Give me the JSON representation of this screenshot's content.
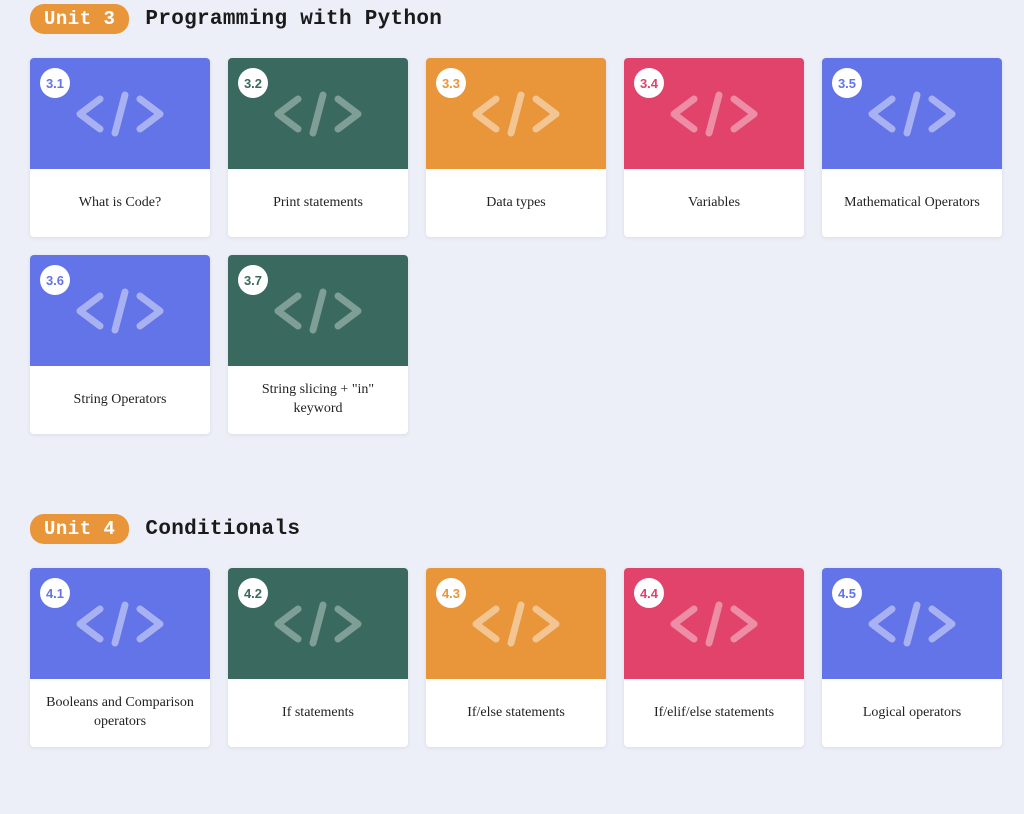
{
  "units": [
    {
      "badge": "Unit 3",
      "title": "Programming with Python",
      "lessons": [
        {
          "num": "3.1",
          "label": "What is Code?",
          "color": "blue"
        },
        {
          "num": "3.2",
          "label": "Print statements",
          "color": "teal"
        },
        {
          "num": "3.3",
          "label": "Data types",
          "color": "orange"
        },
        {
          "num": "3.4",
          "label": "Variables",
          "color": "pink"
        },
        {
          "num": "3.5",
          "label": "Mathematical Operators",
          "color": "blue"
        },
        {
          "num": "3.6",
          "label": "String Operators",
          "color": "blue"
        },
        {
          "num": "3.7",
          "label": "String slicing + \"in\" keyword",
          "color": "teal"
        }
      ]
    },
    {
      "badge": "Unit 4",
      "title": "Conditionals",
      "lessons": [
        {
          "num": "4.1",
          "label": "Booleans and Comparison operators",
          "color": "blue"
        },
        {
          "num": "4.2",
          "label": "If statements",
          "color": "teal"
        },
        {
          "num": "4.3",
          "label": "If/else statements",
          "color": "orange"
        },
        {
          "num": "4.4",
          "label": "If/elif/else statements",
          "color": "pink"
        },
        {
          "num": "4.5",
          "label": "Logical operators",
          "color": "blue"
        }
      ]
    }
  ]
}
